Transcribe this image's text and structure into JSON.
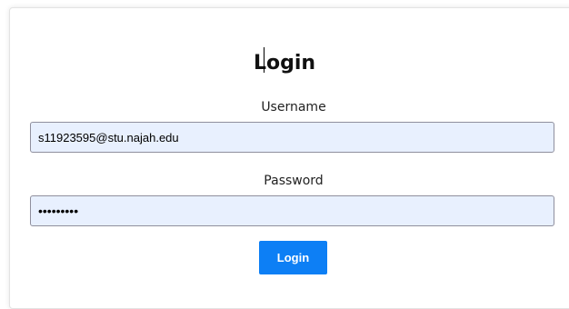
{
  "login_form": {
    "title": "Login",
    "username_label": "Username",
    "username_value": "s11923595@stu.najah.edu",
    "password_label": "Password",
    "password_value": "•••••••••",
    "submit_label": "Login"
  },
  "colors": {
    "button_bg": "#0d7ff5",
    "field_bg": "#e8f0fe"
  }
}
